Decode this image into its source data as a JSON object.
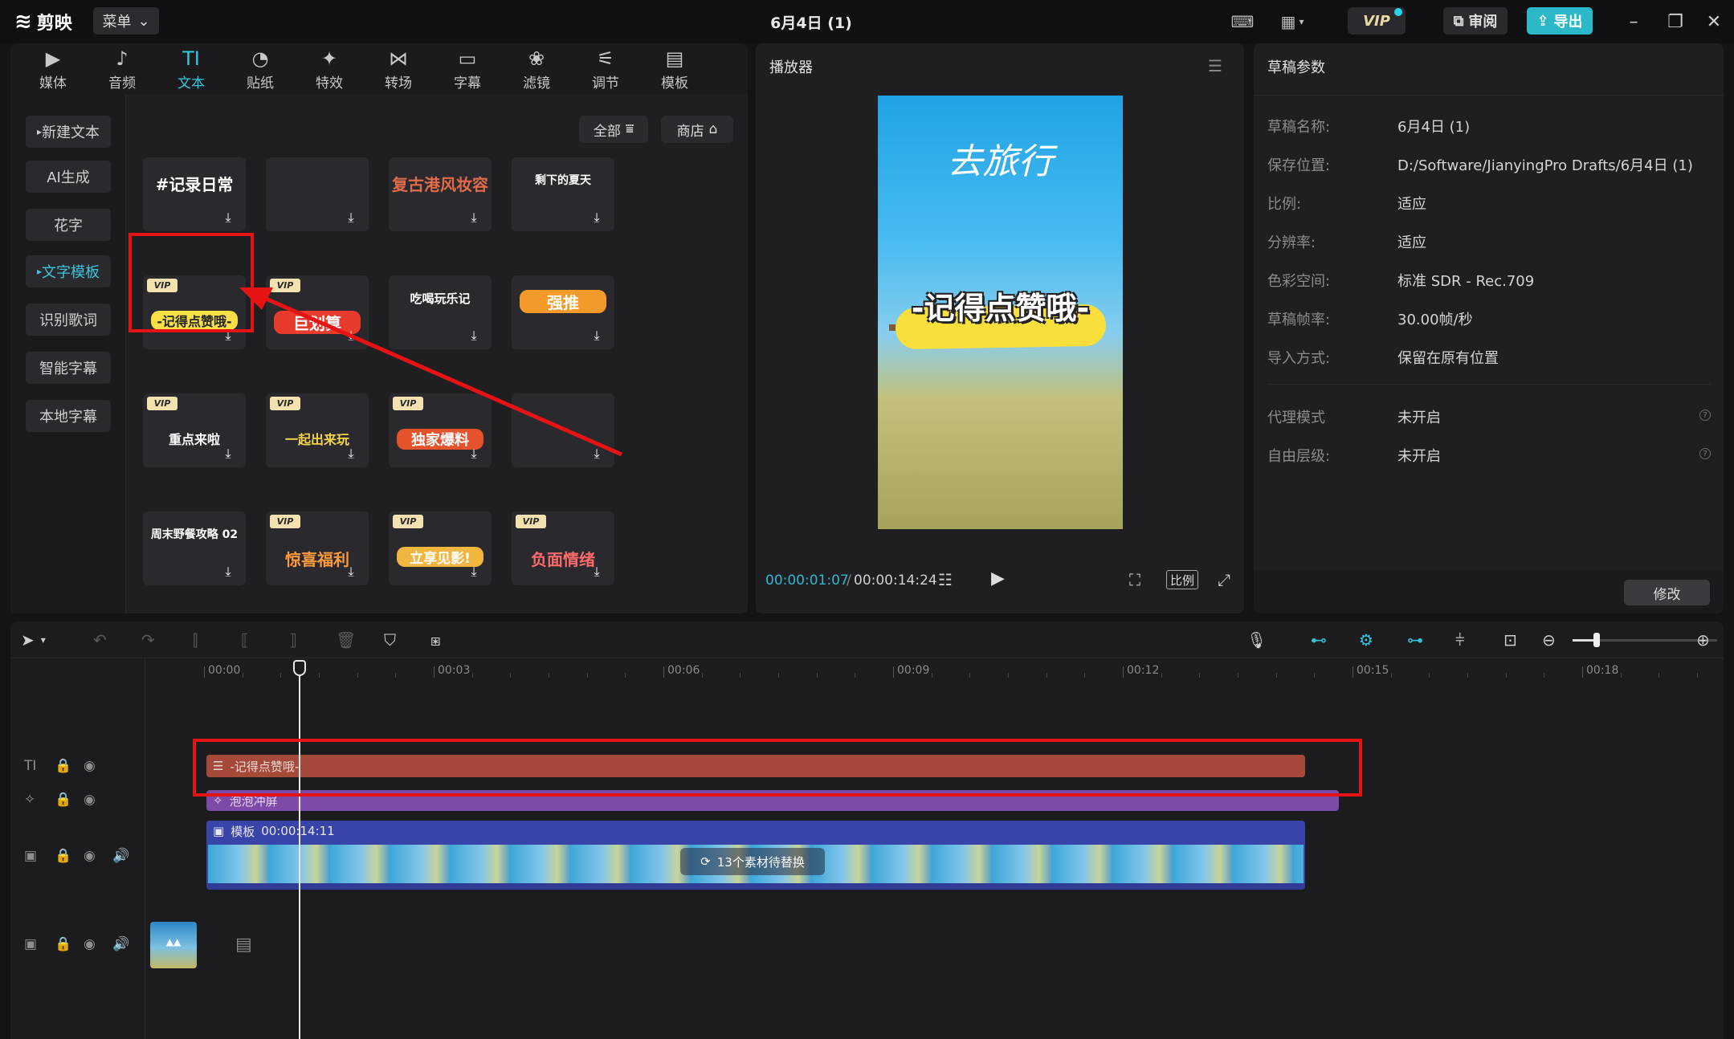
{
  "app": {
    "name": "剪映",
    "menu_label": "菜单",
    "project_title": "6月4日 (1)"
  },
  "titlebar": {
    "vip_label": "VIP",
    "review_label": "审阅",
    "export_label": "导出"
  },
  "toolbar": {
    "items": [
      {
        "label": "媒体",
        "icon": "media-icon"
      },
      {
        "label": "音频",
        "icon": "audio-icon"
      },
      {
        "label": "文本",
        "icon": "text-icon",
        "active": true
      },
      {
        "label": "贴纸",
        "icon": "sticker-icon"
      },
      {
        "label": "特效",
        "icon": "effects-icon"
      },
      {
        "label": "转场",
        "icon": "transition-icon"
      },
      {
        "label": "字幕",
        "icon": "subtitle-icon"
      },
      {
        "label": "滤镜",
        "icon": "filter-icon"
      },
      {
        "label": "调节",
        "icon": "adjust-icon"
      },
      {
        "label": "模板",
        "icon": "template-icon"
      }
    ]
  },
  "categories": {
    "items": [
      "新建文本",
      "AI生成",
      "花字",
      "文字模板",
      "识别歌词",
      "智能字幕",
      "本地字幕"
    ],
    "active": "文字模板"
  },
  "filters": {
    "all_label": "全部",
    "shop_label": "商店"
  },
  "templates": [
    {
      "text": "#记录日常",
      "vip": false
    },
    {
      "text": "",
      "vip": false
    },
    {
      "text": "复古港风妆容",
      "vip": false
    },
    {
      "text": "剩下的夏天",
      "vip": false
    },
    {
      "text": "-记得点赞哦-",
      "vip": true,
      "highlighted": true
    },
    {
      "text": "巨划算",
      "vip": true
    },
    {
      "text": "吃喝玩乐记",
      "vip": false
    },
    {
      "text": "强推",
      "vip": false
    },
    {
      "text": "重点来啦",
      "vip": true
    },
    {
      "text": "一起出来玩",
      "vip": true
    },
    {
      "text": "独家爆料",
      "vip": true
    },
    {
      "text": "",
      "vip": false
    },
    {
      "text": "周末野餐攻略 02",
      "vip": false
    },
    {
      "text": "惊喜福利",
      "vip": true
    },
    {
      "text": "立享见影!",
      "vip": true
    },
    {
      "text": "负面情绪",
      "vip": true
    }
  ],
  "player": {
    "title": "播放器",
    "current_time": "00:00:01:07",
    "total_time": "00:00:14:24",
    "ratio_label": "比例",
    "video_title": "去旅行",
    "video_caption": "-记得点赞哦-"
  },
  "properties": {
    "title": "草稿参数",
    "rows": [
      {
        "key": "草稿名称:",
        "value": "6月4日 (1)"
      },
      {
        "key": "保存位置:",
        "value": "D:/Software/JianyingPro Drafts/6月4日 (1)"
      },
      {
        "key": "比例:",
        "value": "适应"
      },
      {
        "key": "分辨率:",
        "value": "适应"
      },
      {
        "key": "色彩空间:",
        "value": "标准 SDR - Rec.709"
      },
      {
        "key": "草稿帧率:",
        "value": "30.00帧/秒"
      },
      {
        "key": "导入方式:",
        "value": "保留在原有位置"
      }
    ],
    "rows2": [
      {
        "key": "代理模式",
        "value": "未开启"
      },
      {
        "key": "自由层级:",
        "value": "未开启"
      }
    ],
    "modify_label": "修改"
  },
  "timeline": {
    "ruler_labels": [
      "00:00",
      "00:03",
      "00:06",
      "00:09",
      "00:12",
      "00:15",
      "00:18"
    ],
    "text_clip_label": "-记得点赞哦-",
    "effect_clip_label": "泡泡冲屏",
    "video_clip_label": "模板",
    "video_clip_duration": "00:00:14:11",
    "replace_label": "13个素材待替换"
  },
  "colors": {
    "accent": "#2fc6d9",
    "text_clip": "#a54a3b",
    "effect_clip": "#7e4aa7",
    "video_clip": "#3844a8",
    "highlight": "#e51313"
  }
}
